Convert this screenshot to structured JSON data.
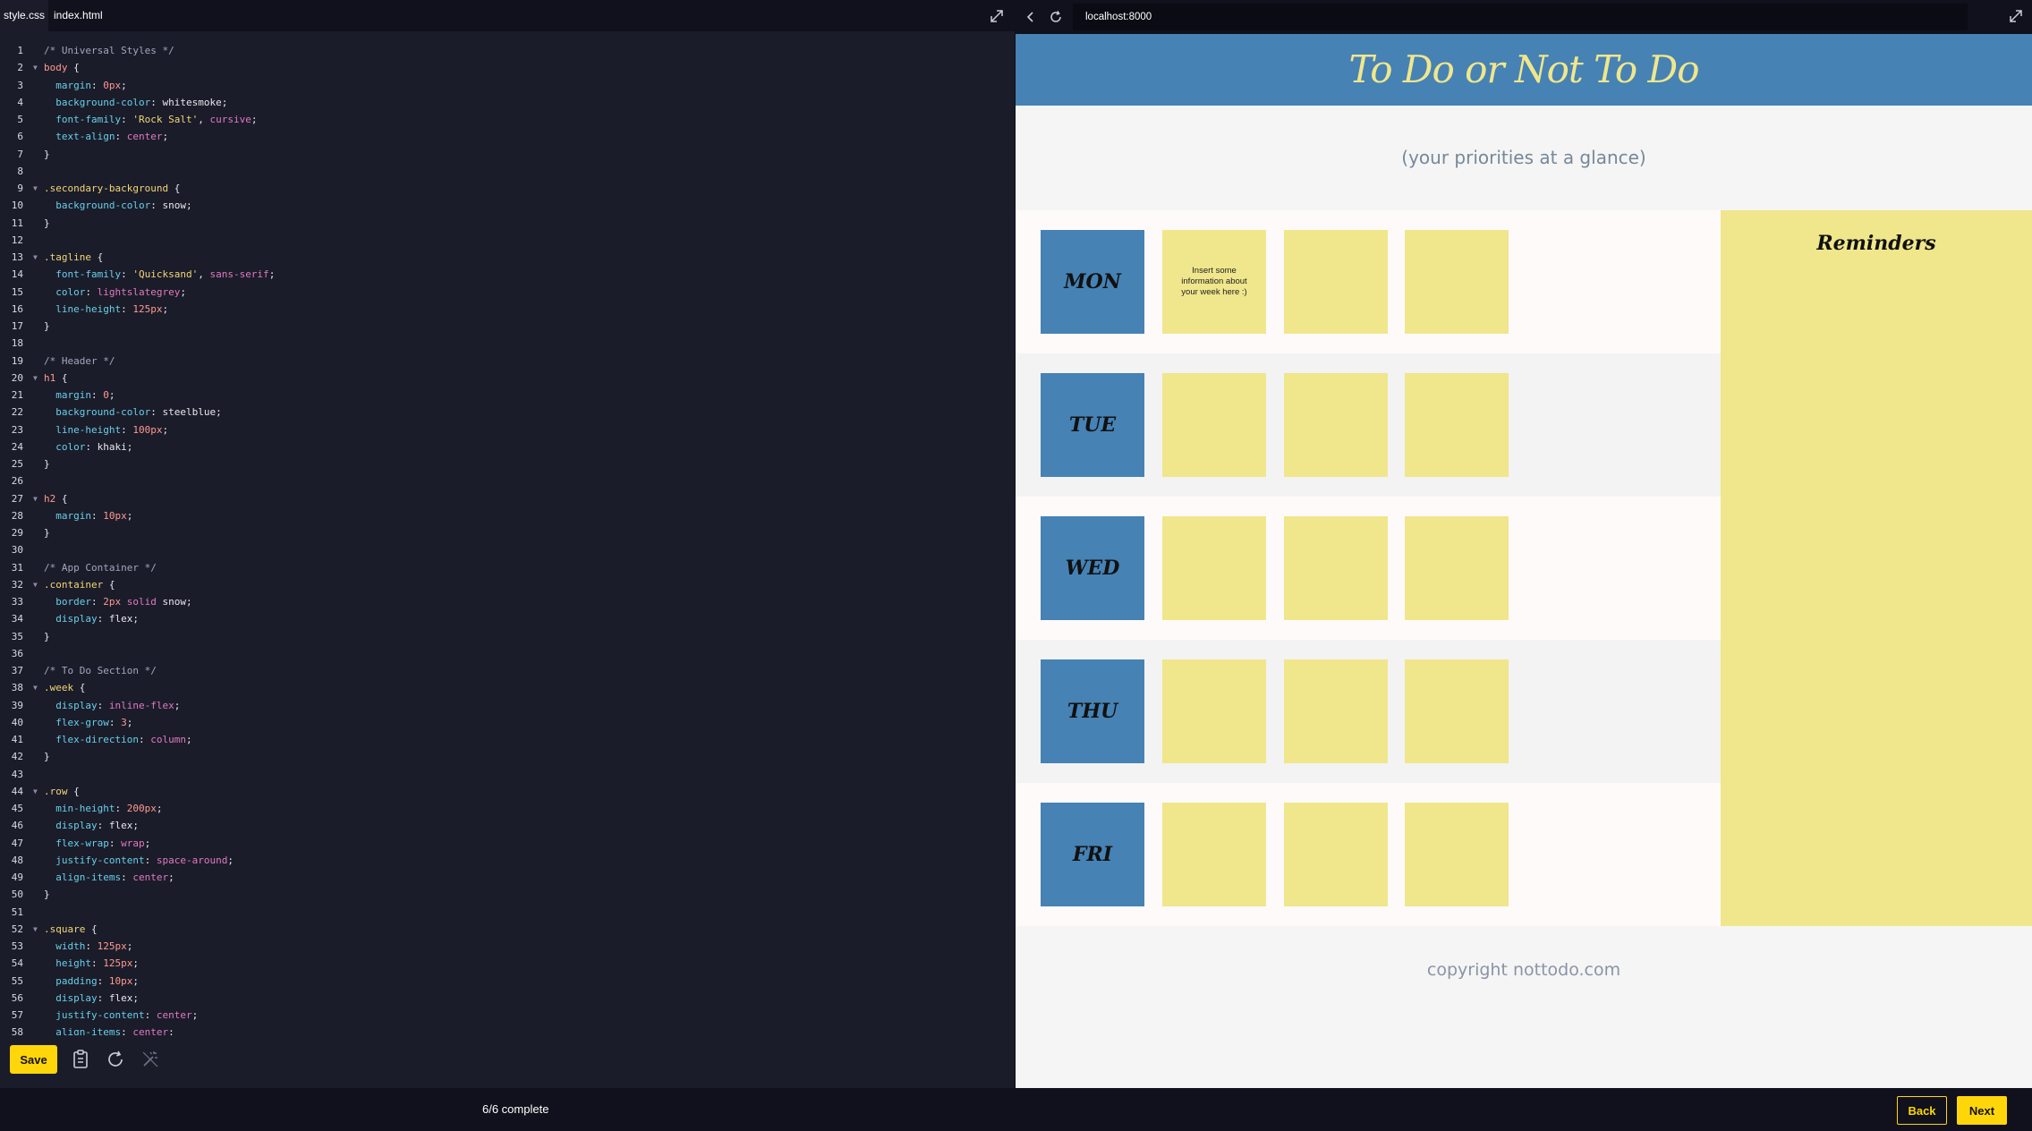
{
  "editor": {
    "tabs": [
      {
        "label": "style.css"
      },
      {
        "label": "index.html"
      }
    ],
    "active_tab": "style.css",
    "code_lines": [
      [
        [
          "/* Universal Styles */",
          "comment"
        ]
      ],
      [
        [
          "body",
          "tag"
        ],
        [
          " {",
          "punc"
        ]
      ],
      [
        [
          "  margin",
          "prop"
        ],
        [
          ": ",
          "punc"
        ],
        [
          "0px",
          "num"
        ],
        [
          ";",
          "punc"
        ]
      ],
      [
        [
          "  background-color",
          "prop"
        ],
        [
          ": ",
          "punc"
        ],
        [
          "whitesmoke",
          "val"
        ],
        [
          ";",
          "punc"
        ]
      ],
      [
        [
          "  font-family",
          "prop"
        ],
        [
          ": ",
          "punc"
        ],
        [
          "'Rock Salt'",
          "str"
        ],
        [
          ", ",
          "punc"
        ],
        [
          "cursive",
          "kw"
        ],
        [
          ";",
          "punc"
        ]
      ],
      [
        [
          "  text-align",
          "prop"
        ],
        [
          ": ",
          "punc"
        ],
        [
          "center",
          "kw"
        ],
        [
          ";",
          "punc"
        ]
      ],
      [
        [
          "}",
          "punc"
        ]
      ],
      [],
      [
        [
          ".secondary-background",
          "sel"
        ],
        [
          " {",
          "punc"
        ]
      ],
      [
        [
          "  background-color",
          "prop"
        ],
        [
          ": ",
          "punc"
        ],
        [
          "snow",
          "val"
        ],
        [
          ";",
          "punc"
        ]
      ],
      [
        [
          "}",
          "punc"
        ]
      ],
      [],
      [
        [
          ".tagline",
          "sel"
        ],
        [
          " {",
          "punc"
        ]
      ],
      [
        [
          "  font-family",
          "prop"
        ],
        [
          ": ",
          "punc"
        ],
        [
          "'Quicksand'",
          "str"
        ],
        [
          ", ",
          "punc"
        ],
        [
          "sans-serif",
          "kw"
        ],
        [
          ";",
          "punc"
        ]
      ],
      [
        [
          "  color",
          "prop"
        ],
        [
          ": ",
          "punc"
        ],
        [
          "lightslategrey",
          "kw"
        ],
        [
          ";",
          "punc"
        ]
      ],
      [
        [
          "  line-height",
          "prop"
        ],
        [
          ": ",
          "punc"
        ],
        [
          "125px",
          "num"
        ],
        [
          ";",
          "punc"
        ]
      ],
      [
        [
          "}",
          "punc"
        ]
      ],
      [],
      [
        [
          "/* Header */",
          "comment"
        ]
      ],
      [
        [
          "h1",
          "tag"
        ],
        [
          " {",
          "punc"
        ]
      ],
      [
        [
          "  margin",
          "prop"
        ],
        [
          ": ",
          "punc"
        ],
        [
          "0",
          "num"
        ],
        [
          ";",
          "punc"
        ]
      ],
      [
        [
          "  background-color",
          "prop"
        ],
        [
          ": ",
          "punc"
        ],
        [
          "steelblue",
          "val"
        ],
        [
          ";",
          "punc"
        ]
      ],
      [
        [
          "  line-height",
          "prop"
        ],
        [
          ": ",
          "punc"
        ],
        [
          "100px",
          "num"
        ],
        [
          ";",
          "punc"
        ]
      ],
      [
        [
          "  color",
          "prop"
        ],
        [
          ": ",
          "punc"
        ],
        [
          "khaki",
          "val"
        ],
        [
          ";",
          "punc"
        ]
      ],
      [
        [
          "}",
          "punc"
        ]
      ],
      [],
      [
        [
          "h2",
          "tag"
        ],
        [
          " {",
          "punc"
        ]
      ],
      [
        [
          "  margin",
          "prop"
        ],
        [
          ": ",
          "punc"
        ],
        [
          "10px",
          "num"
        ],
        [
          ";",
          "punc"
        ]
      ],
      [
        [
          "}",
          "punc"
        ]
      ],
      [],
      [
        [
          "/* App Container */",
          "comment"
        ]
      ],
      [
        [
          ".container",
          "sel"
        ],
        [
          " {",
          "punc"
        ]
      ],
      [
        [
          "  border",
          "prop"
        ],
        [
          ": ",
          "punc"
        ],
        [
          "2px",
          "num"
        ],
        [
          " ",
          "punc"
        ],
        [
          "solid",
          "kw"
        ],
        [
          " ",
          "punc"
        ],
        [
          "snow",
          "val"
        ],
        [
          ";",
          "punc"
        ]
      ],
      [
        [
          "  display",
          "prop"
        ],
        [
          ": ",
          "punc"
        ],
        [
          "flex",
          "val"
        ],
        [
          ";",
          "punc"
        ]
      ],
      [
        [
          "}",
          "punc"
        ]
      ],
      [],
      [
        [
          "/* To Do Section */",
          "comment"
        ]
      ],
      [
        [
          ".week",
          "sel"
        ],
        [
          " {",
          "punc"
        ]
      ],
      [
        [
          "  display",
          "prop"
        ],
        [
          ": ",
          "punc"
        ],
        [
          "inline-flex",
          "kw"
        ],
        [
          ";",
          "punc"
        ]
      ],
      [
        [
          "  flex-grow",
          "prop"
        ],
        [
          ": ",
          "punc"
        ],
        [
          "3",
          "num"
        ],
        [
          ";",
          "punc"
        ]
      ],
      [
        [
          "  flex-direction",
          "prop"
        ],
        [
          ": ",
          "punc"
        ],
        [
          "column",
          "kw"
        ],
        [
          ";",
          "punc"
        ]
      ],
      [
        [
          "}",
          "punc"
        ]
      ],
      [],
      [
        [
          ".row",
          "sel"
        ],
        [
          " {",
          "punc"
        ]
      ],
      [
        [
          "  min-height",
          "prop"
        ],
        [
          ": ",
          "punc"
        ],
        [
          "200px",
          "num"
        ],
        [
          ";",
          "punc"
        ]
      ],
      [
        [
          "  display",
          "prop"
        ],
        [
          ": ",
          "punc"
        ],
        [
          "flex",
          "val"
        ],
        [
          ";",
          "punc"
        ]
      ],
      [
        [
          "  flex-wrap",
          "prop"
        ],
        [
          ": ",
          "punc"
        ],
        [
          "wrap",
          "kw"
        ],
        [
          ";",
          "punc"
        ]
      ],
      [
        [
          "  justify-content",
          "prop"
        ],
        [
          ": ",
          "punc"
        ],
        [
          "space-around",
          "kw"
        ],
        [
          ";",
          "punc"
        ]
      ],
      [
        [
          "  align-items",
          "prop"
        ],
        [
          ": ",
          "punc"
        ],
        [
          "center",
          "kw"
        ],
        [
          ";",
          "punc"
        ]
      ],
      [
        [
          "}",
          "punc"
        ]
      ],
      [],
      [
        [
          ".square",
          "sel"
        ],
        [
          " {",
          "punc"
        ]
      ],
      [
        [
          "  width",
          "prop"
        ],
        [
          ": ",
          "punc"
        ],
        [
          "125px",
          "num"
        ],
        [
          ";",
          "punc"
        ]
      ],
      [
        [
          "  height",
          "prop"
        ],
        [
          ": ",
          "punc"
        ],
        [
          "125px",
          "num"
        ],
        [
          ";",
          "punc"
        ]
      ],
      [
        [
          "  padding",
          "prop"
        ],
        [
          ": ",
          "punc"
        ],
        [
          "10px",
          "num"
        ],
        [
          ";",
          "punc"
        ]
      ],
      [
        [
          "  display",
          "prop"
        ],
        [
          ": ",
          "punc"
        ],
        [
          "flex",
          "val"
        ],
        [
          ";",
          "punc"
        ]
      ],
      [
        [
          "  justify-content",
          "prop"
        ],
        [
          ": ",
          "punc"
        ],
        [
          "center",
          "kw"
        ],
        [
          ";",
          "punc"
        ]
      ],
      [
        [
          "  align-items",
          "prop"
        ],
        [
          ": ",
          "punc"
        ],
        [
          "center",
          "kw"
        ],
        [
          ";",
          "punc"
        ]
      ]
    ],
    "fold_lines": [
      2,
      9,
      13,
      20,
      27,
      32,
      38,
      44,
      52
    ],
    "save_label": "Save"
  },
  "browser": {
    "url": "localhost:8000",
    "page": {
      "title": "To Do or Not To Do",
      "tagline": "(your priorities at a glance)",
      "days": [
        "MON",
        "TUE",
        "WED",
        "THU",
        "FRI"
      ],
      "first_note": "Insert some information about your week here :)",
      "reminders_title": "Reminders",
      "footer": "copyright nottodo.com"
    }
  },
  "bottom_bar": {
    "progress": "6/6 complete",
    "back_label": "Back",
    "next_label": "Next"
  },
  "colors": {
    "accent": "#ffd60a",
    "header_bg": "#4682b4",
    "header_text": "#f0e68c",
    "note_bg": "#f0e68c"
  }
}
